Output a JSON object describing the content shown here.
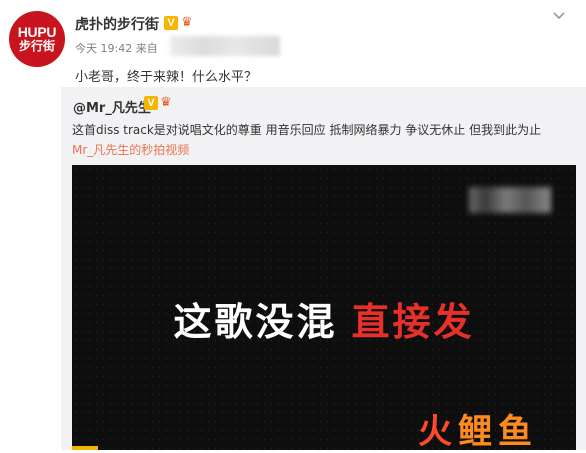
{
  "post": {
    "avatar": {
      "line1": "HUPU",
      "line2": "步行街"
    },
    "author": "虎扑的步行街",
    "verified_badge": "V",
    "level_badge_icon": "vip-crown-icon",
    "time": "今天 19:42 来自",
    "text": "小老哥，终于来辣！什么水平？"
  },
  "repost": {
    "author": "@Mr_凡先生",
    "verified_badge": "V",
    "level_badge_icon": "vip-crown-icon",
    "text": "这首diss track是对说唱文化的尊重  用音乐回应  抵制网络暴力 争议无休止 但我到此为止",
    "link": "Mr_凡先生的秒拍视频",
    "video": {
      "caption_white": "这歌没混",
      "caption_red": "直接发"
    }
  },
  "watermark": {
    "fire": "火",
    "rest": "鲤鱼"
  },
  "colors": {
    "brand_red": "#c8141e",
    "link_orange": "#eb7350",
    "verified_yellow": "#f7b500",
    "caption_red": "#e8302b"
  }
}
